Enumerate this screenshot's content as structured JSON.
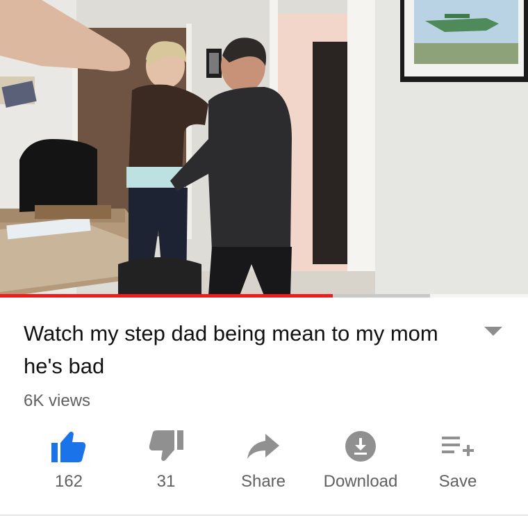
{
  "video": {
    "title": "Watch my step dad being mean to my mom he's bad",
    "views": "6K views",
    "progress_played": 0.63,
    "progress_buffered": 0.815
  },
  "actions": {
    "like_count": "162",
    "dislike_count": "31",
    "share_label": "Share",
    "download_label": "Download",
    "save_label": "Save"
  },
  "icons": {
    "like": "thumbs-up-icon",
    "dislike": "thumbs-down-icon",
    "share": "share-arrow-icon",
    "download": "download-icon",
    "save": "playlist-add-icon",
    "expand": "chevron-down-icon"
  },
  "colors": {
    "accent_like": "#1a73e8",
    "progress_red": "#ee1c1b",
    "icon_gray": "#909090",
    "text_primary": "#111111",
    "text_secondary": "#606060"
  }
}
